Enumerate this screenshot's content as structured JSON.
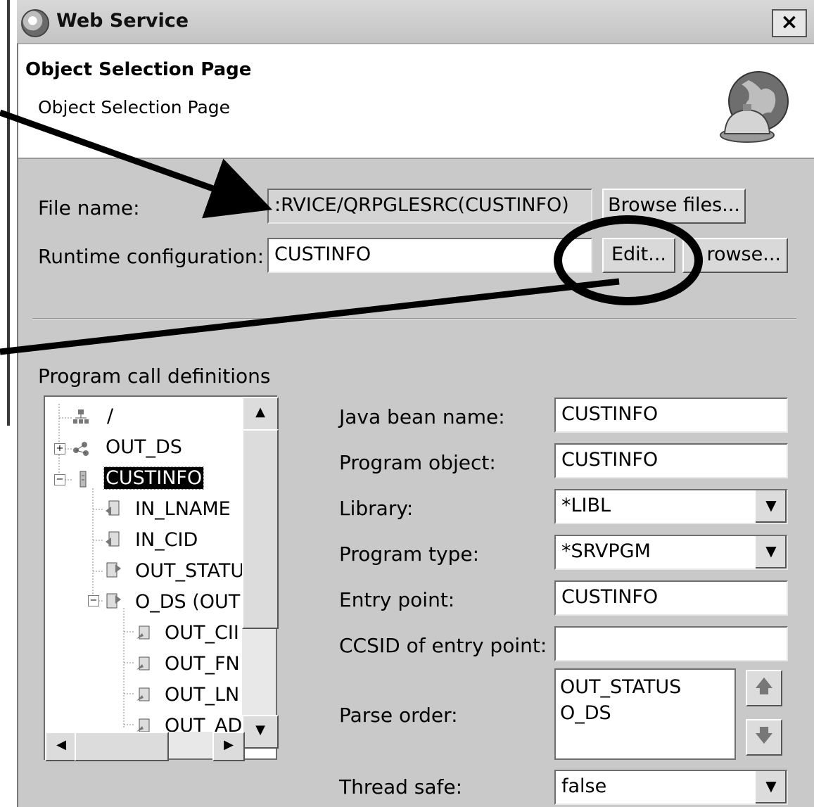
{
  "window": {
    "title": "Web Service",
    "close_label": "×"
  },
  "header": {
    "title": "Object Selection Page",
    "description": "Object Selection Page"
  },
  "form": {
    "file_name_label": "File name:",
    "file_name_value": ":RVICE/QRPGLESRC(CUSTINFO)",
    "browse_files_label": "Browse files...",
    "runtime_config_label": "Runtime configuration:",
    "runtime_config_value": "CUSTINFO",
    "edit_label": "Edit...",
    "browse_label": "rowse..."
  },
  "program_calls": {
    "section_label": "Program call definitions",
    "tree": [
      {
        "label": "/",
        "icon": "network-root-icon"
      },
      {
        "label": "OUT_DS",
        "icon": "struct-icon",
        "expander": "+"
      },
      {
        "label": "CUSTINFO",
        "icon": "program-icon",
        "expander": "−",
        "selected": true
      },
      {
        "label": "IN_LNAME",
        "icon": "parameter-in-icon"
      },
      {
        "label": "IN_CID",
        "icon": "parameter-in-icon"
      },
      {
        "label": "OUT_STATU",
        "icon": "parameter-out-icon"
      },
      {
        "label": "O_DS (OUT",
        "icon": "parameter-out-icon",
        "expander": "−"
      },
      {
        "label": "OUT_CII",
        "icon": "field-icon"
      },
      {
        "label": "OUT_FN",
        "icon": "field-icon"
      },
      {
        "label": "OUT_LN",
        "icon": "field-icon"
      },
      {
        "label": "OUT_AD",
        "icon": "field-icon"
      }
    ]
  },
  "details": {
    "java_bean_label": "Java bean name:",
    "java_bean_value": "CUSTINFO",
    "program_object_label": "Program object:",
    "program_object_value": "CUSTINFO",
    "library_label": "Library:",
    "library_value": "*LIBL",
    "program_type_label": "Program type:",
    "program_type_value": "*SRVPGM",
    "entry_point_label": "Entry point:",
    "entry_point_value": "CUSTINFO",
    "ccsid_label": "CCSID of entry point:",
    "ccsid_value": "",
    "parse_order_label": "Parse order:",
    "parse_order_items": [
      "OUT_STATUS",
      "O_DS"
    ],
    "thread_safe_label": "Thread safe:",
    "thread_safe_value": "false"
  }
}
